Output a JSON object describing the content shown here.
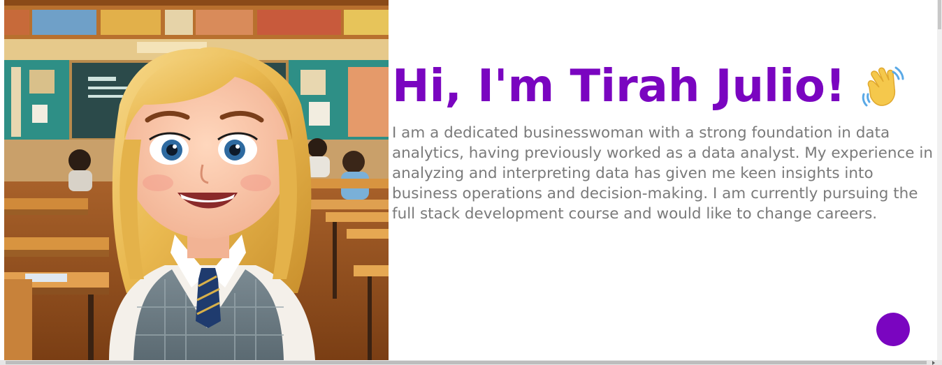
{
  "hero": {
    "greeting": "Hi, I'm Tirah Julio!",
    "wave_icon": "waving-hand-emoji",
    "bio": "I am a dedicated businesswoman with a strong foundation in data analytics, having previously worked as a data analyst. My experience in analyzing and interpreting data has given me keen insights into business operations and decision-making. I am currently pursuing the full stack development course and would like to change careers."
  },
  "portrait": {
    "subject": "cartoon-girl-in-classroom"
  },
  "colors": {
    "accent": "#7a05c0",
    "body_text": "#7a7a7a",
    "background": "#ffffff"
  },
  "fab": {
    "icon": "purple-circle"
  }
}
